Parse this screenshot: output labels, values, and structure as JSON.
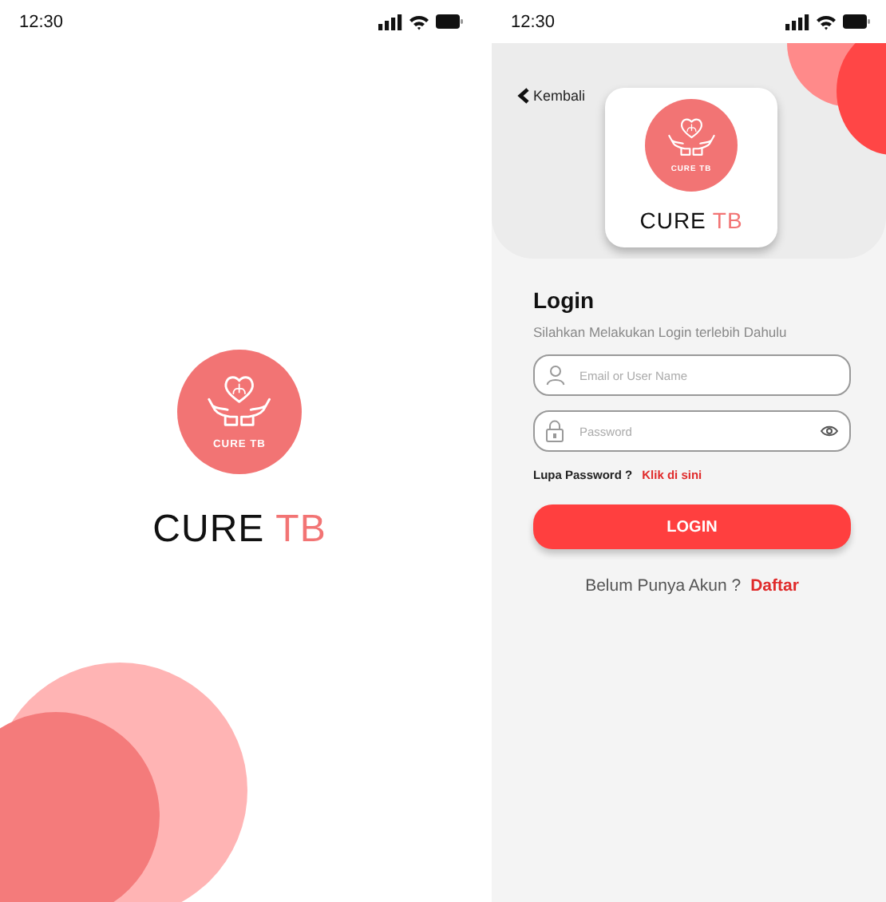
{
  "splash_screen": {
    "status_bar": {
      "time": "12:30"
    },
    "logo": {
      "badge_text": "CURE TB",
      "title": "CURE",
      "title_accent": "TB"
    }
  },
  "login_screen": {
    "status_bar": {
      "time": "12:30"
    },
    "back_link": "Kembali",
    "logo": {
      "badge_text": "CURE TB",
      "title": "CURE",
      "title_accent": "TB"
    },
    "title": "Login",
    "subtitle": "Silahkan Melakukan Login terlebih Dahulu",
    "email_field": {
      "placeholder": "Email or User Name"
    },
    "password_field": {
      "placeholder": "Password"
    },
    "forgot_text": "Lupa Password ?",
    "forgot_link": "Klik di sini",
    "login_button": "LOGIN",
    "register_text": "Belum Punya Akun ?",
    "register_link": "Daftar"
  }
}
